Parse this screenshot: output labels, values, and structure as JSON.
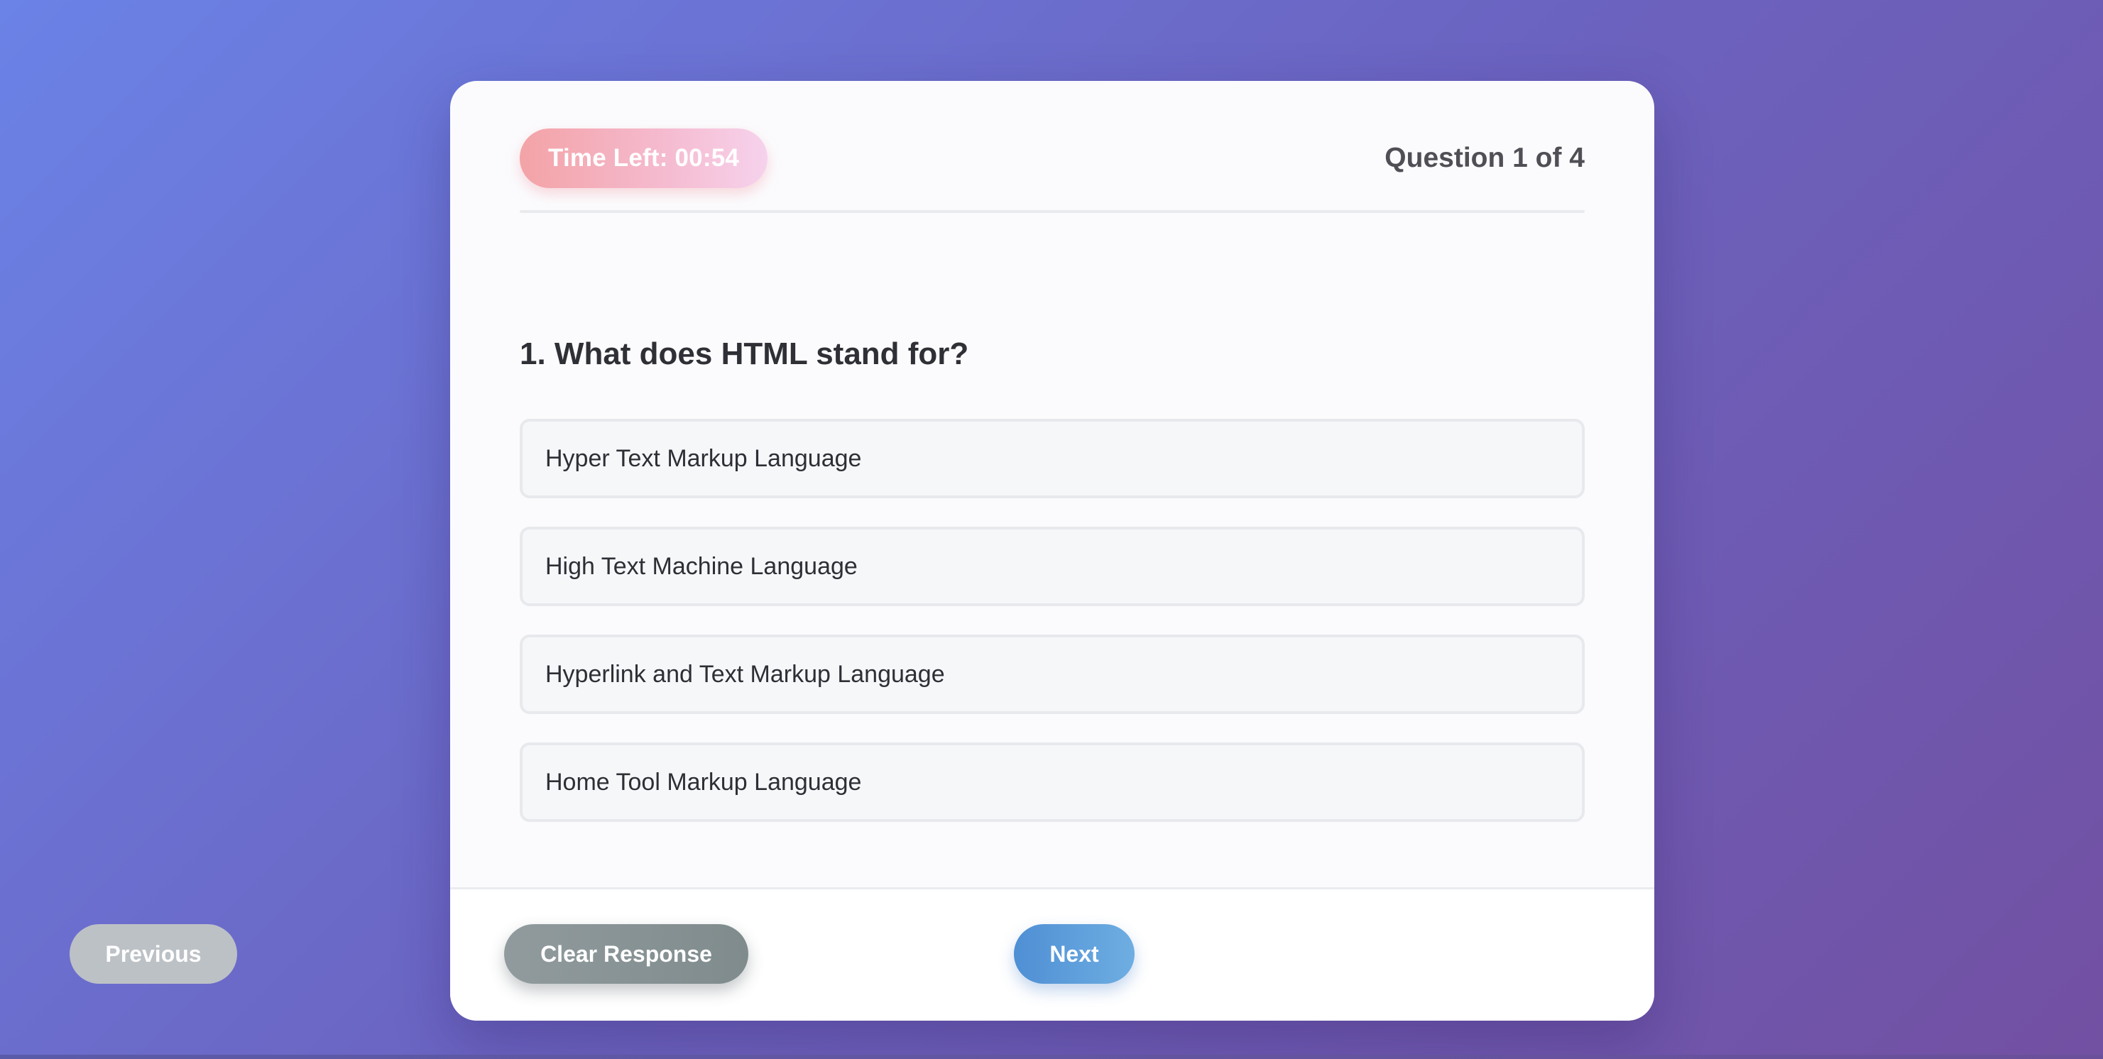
{
  "timer": {
    "label": "Time Left: 00:54"
  },
  "progress": {
    "label": "Question 1 of 4",
    "current": 1,
    "total": 4
  },
  "question": {
    "text": "1. What does HTML stand for?",
    "options": [
      "Hyper Text Markup Language",
      "High Text Machine Language",
      "Hyperlink and Text Markup Language",
      "Home Tool Markup Language"
    ]
  },
  "footer": {
    "previous_label": "Previous",
    "clear_label": "Clear Response",
    "next_label": "Next"
  },
  "colors": {
    "background_start": "#6b82e6",
    "background_end": "#7250a2",
    "timer_start": "#f3a3a6",
    "timer_end": "#f6d2ec",
    "previous_button": "#bcc1c6",
    "clear_button": "#879294",
    "next_button": "#5c9edb"
  }
}
